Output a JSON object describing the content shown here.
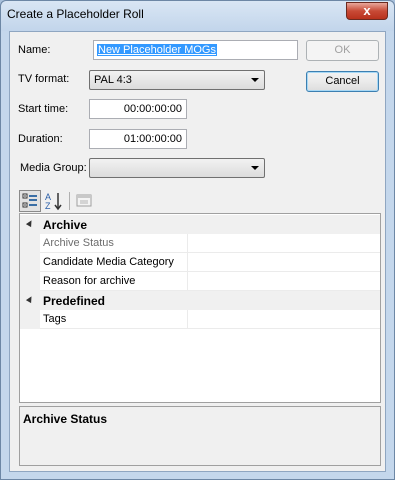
{
  "window": {
    "title": "Create a Placeholder Roll",
    "close_glyph": "x"
  },
  "form": {
    "name_label": "Name:",
    "name_value": "New Placeholder MOGs",
    "tv_format_label": "TV format:",
    "tv_format_value": "PAL 4:3",
    "start_time_label": "Start time:",
    "start_time_value": "00:00:00:00",
    "duration_label": "Duration:",
    "duration_value": "01:00:00:00",
    "media_group_label": "Media Group:",
    "media_group_value": ""
  },
  "buttons": {
    "ok_label": "OK",
    "cancel_label": "Cancel"
  },
  "toolbar": {
    "categorized_icon": "categorized-view-icon",
    "alphabetical_icon": "sort-alphabetical-icon",
    "property_pages_icon": "property-pages-icon"
  },
  "property_grid": {
    "categories": [
      {
        "name": "Archive",
        "items": [
          {
            "name": "Archive Status",
            "value": "",
            "selected": true
          },
          {
            "name": "Candidate Media Category",
            "value": ""
          },
          {
            "name": "Reason for archive",
            "value": ""
          }
        ]
      },
      {
        "name": "Predefined",
        "items": [
          {
            "name": "Tags",
            "value": ""
          }
        ]
      }
    ]
  },
  "description": {
    "title": "Archive Status"
  },
  "colors": {
    "selection": "#3399ff",
    "window_frame": "#c4d7ec",
    "close_button": "#c84a36"
  }
}
